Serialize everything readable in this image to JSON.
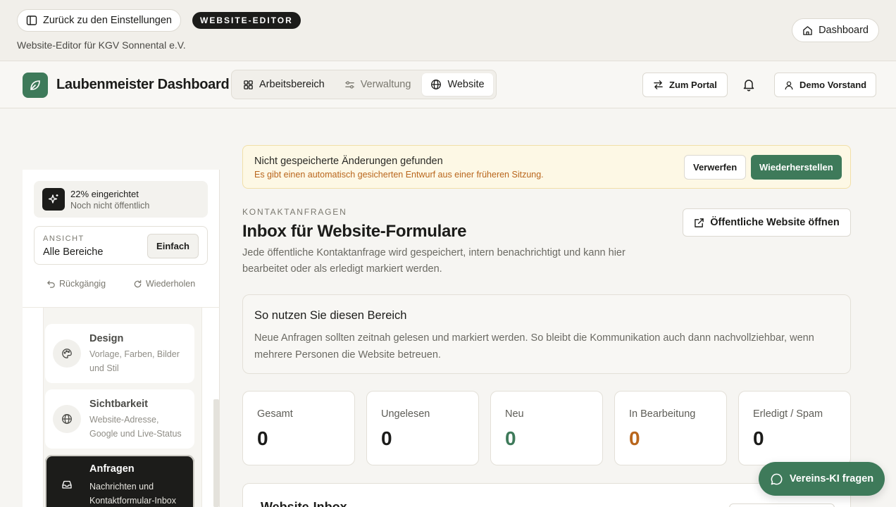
{
  "editor_bar": {
    "back_label": "Zurück zu den Einstellungen",
    "badge": "WEBSITE-EDITOR",
    "subtitle": "Website-Editor für KGV Sonnental e.V.",
    "dashboard_label": "Dashboard"
  },
  "header": {
    "app_title": "Laubenmeister Dashboard",
    "tabs": [
      {
        "label": "Arbeitsbereich",
        "icon": "grid-icon"
      },
      {
        "label": "Verwaltung",
        "icon": "sliders-icon"
      },
      {
        "label": "Website",
        "icon": "globe-icon",
        "active": true
      }
    ],
    "portal_label": "Zum Portal",
    "user_label": "Demo Vorstand"
  },
  "sidebar": {
    "progress": {
      "title": "22% eingerichtet",
      "percent": 22,
      "subtitle": "Noch nicht öffentlich"
    },
    "view": {
      "label": "ANSICHT",
      "value": "Alle Bereiche",
      "mode_button": "Einfach"
    },
    "undo_label": "Rückgängig",
    "redo_label": "Wiederholen",
    "items": [
      {
        "title": "Design",
        "description": "Vorlage, Farben, Bilder und Stil",
        "icon": "palette-icon"
      },
      {
        "title": "Sichtbarkeit",
        "description": "Website-Adresse, Google und Live-Status",
        "icon": "globe-icon"
      },
      {
        "title": "Anfragen",
        "description": "Nachrichten und Kontaktformular-Inbox",
        "icon": "inbox-icon",
        "active": true
      }
    ]
  },
  "alert": {
    "title": "Nicht gespeicherte Änderungen gefunden",
    "message": "Es gibt einen automatisch gesicherten Entwurf aus einer früheren Sitzung.",
    "discard_label": "Verwerfen",
    "restore_label": "Wiederherstellen"
  },
  "main": {
    "eyebrow": "KONTAKTANFRAGEN",
    "title": "Inbox für Website-Formulare",
    "description": "Jede öffentliche Kontaktanfrage wird gespeichert, intern benachrichtigt und kann hier bearbeitet oder als erledigt markiert werden.",
    "public_button": "Öffentliche Website öffnen",
    "info": {
      "title": "So nutzen Sie diesen Bereich",
      "text": "Neue Anfragen sollten zeitnah gelesen und markiert werden. So bleibt die Kommunikation auch dann nachvollziehbar, wenn mehrere Personen die Website betreuen."
    },
    "stats": [
      {
        "label": "Gesamt",
        "value": "0",
        "color": "#1c1c1a"
      },
      {
        "label": "Ungelesen",
        "value": "0",
        "color": "#1c1c1a"
      },
      {
        "label": "Neu",
        "value": "0",
        "color": "#3e7a5a"
      },
      {
        "label": "In Bearbeitung",
        "value": "0",
        "color": "#b9661c"
      },
      {
        "label": "Erledigt / Spam",
        "value": "0",
        "color": "#1c1c1a"
      }
    ],
    "inbox_title": "Website-Inbox"
  },
  "ai_button": "Vereins-KI fragen",
  "colors": {
    "accent": "#3e7a5a",
    "warning": "#b9661c",
    "dark": "#1c1c1a"
  }
}
